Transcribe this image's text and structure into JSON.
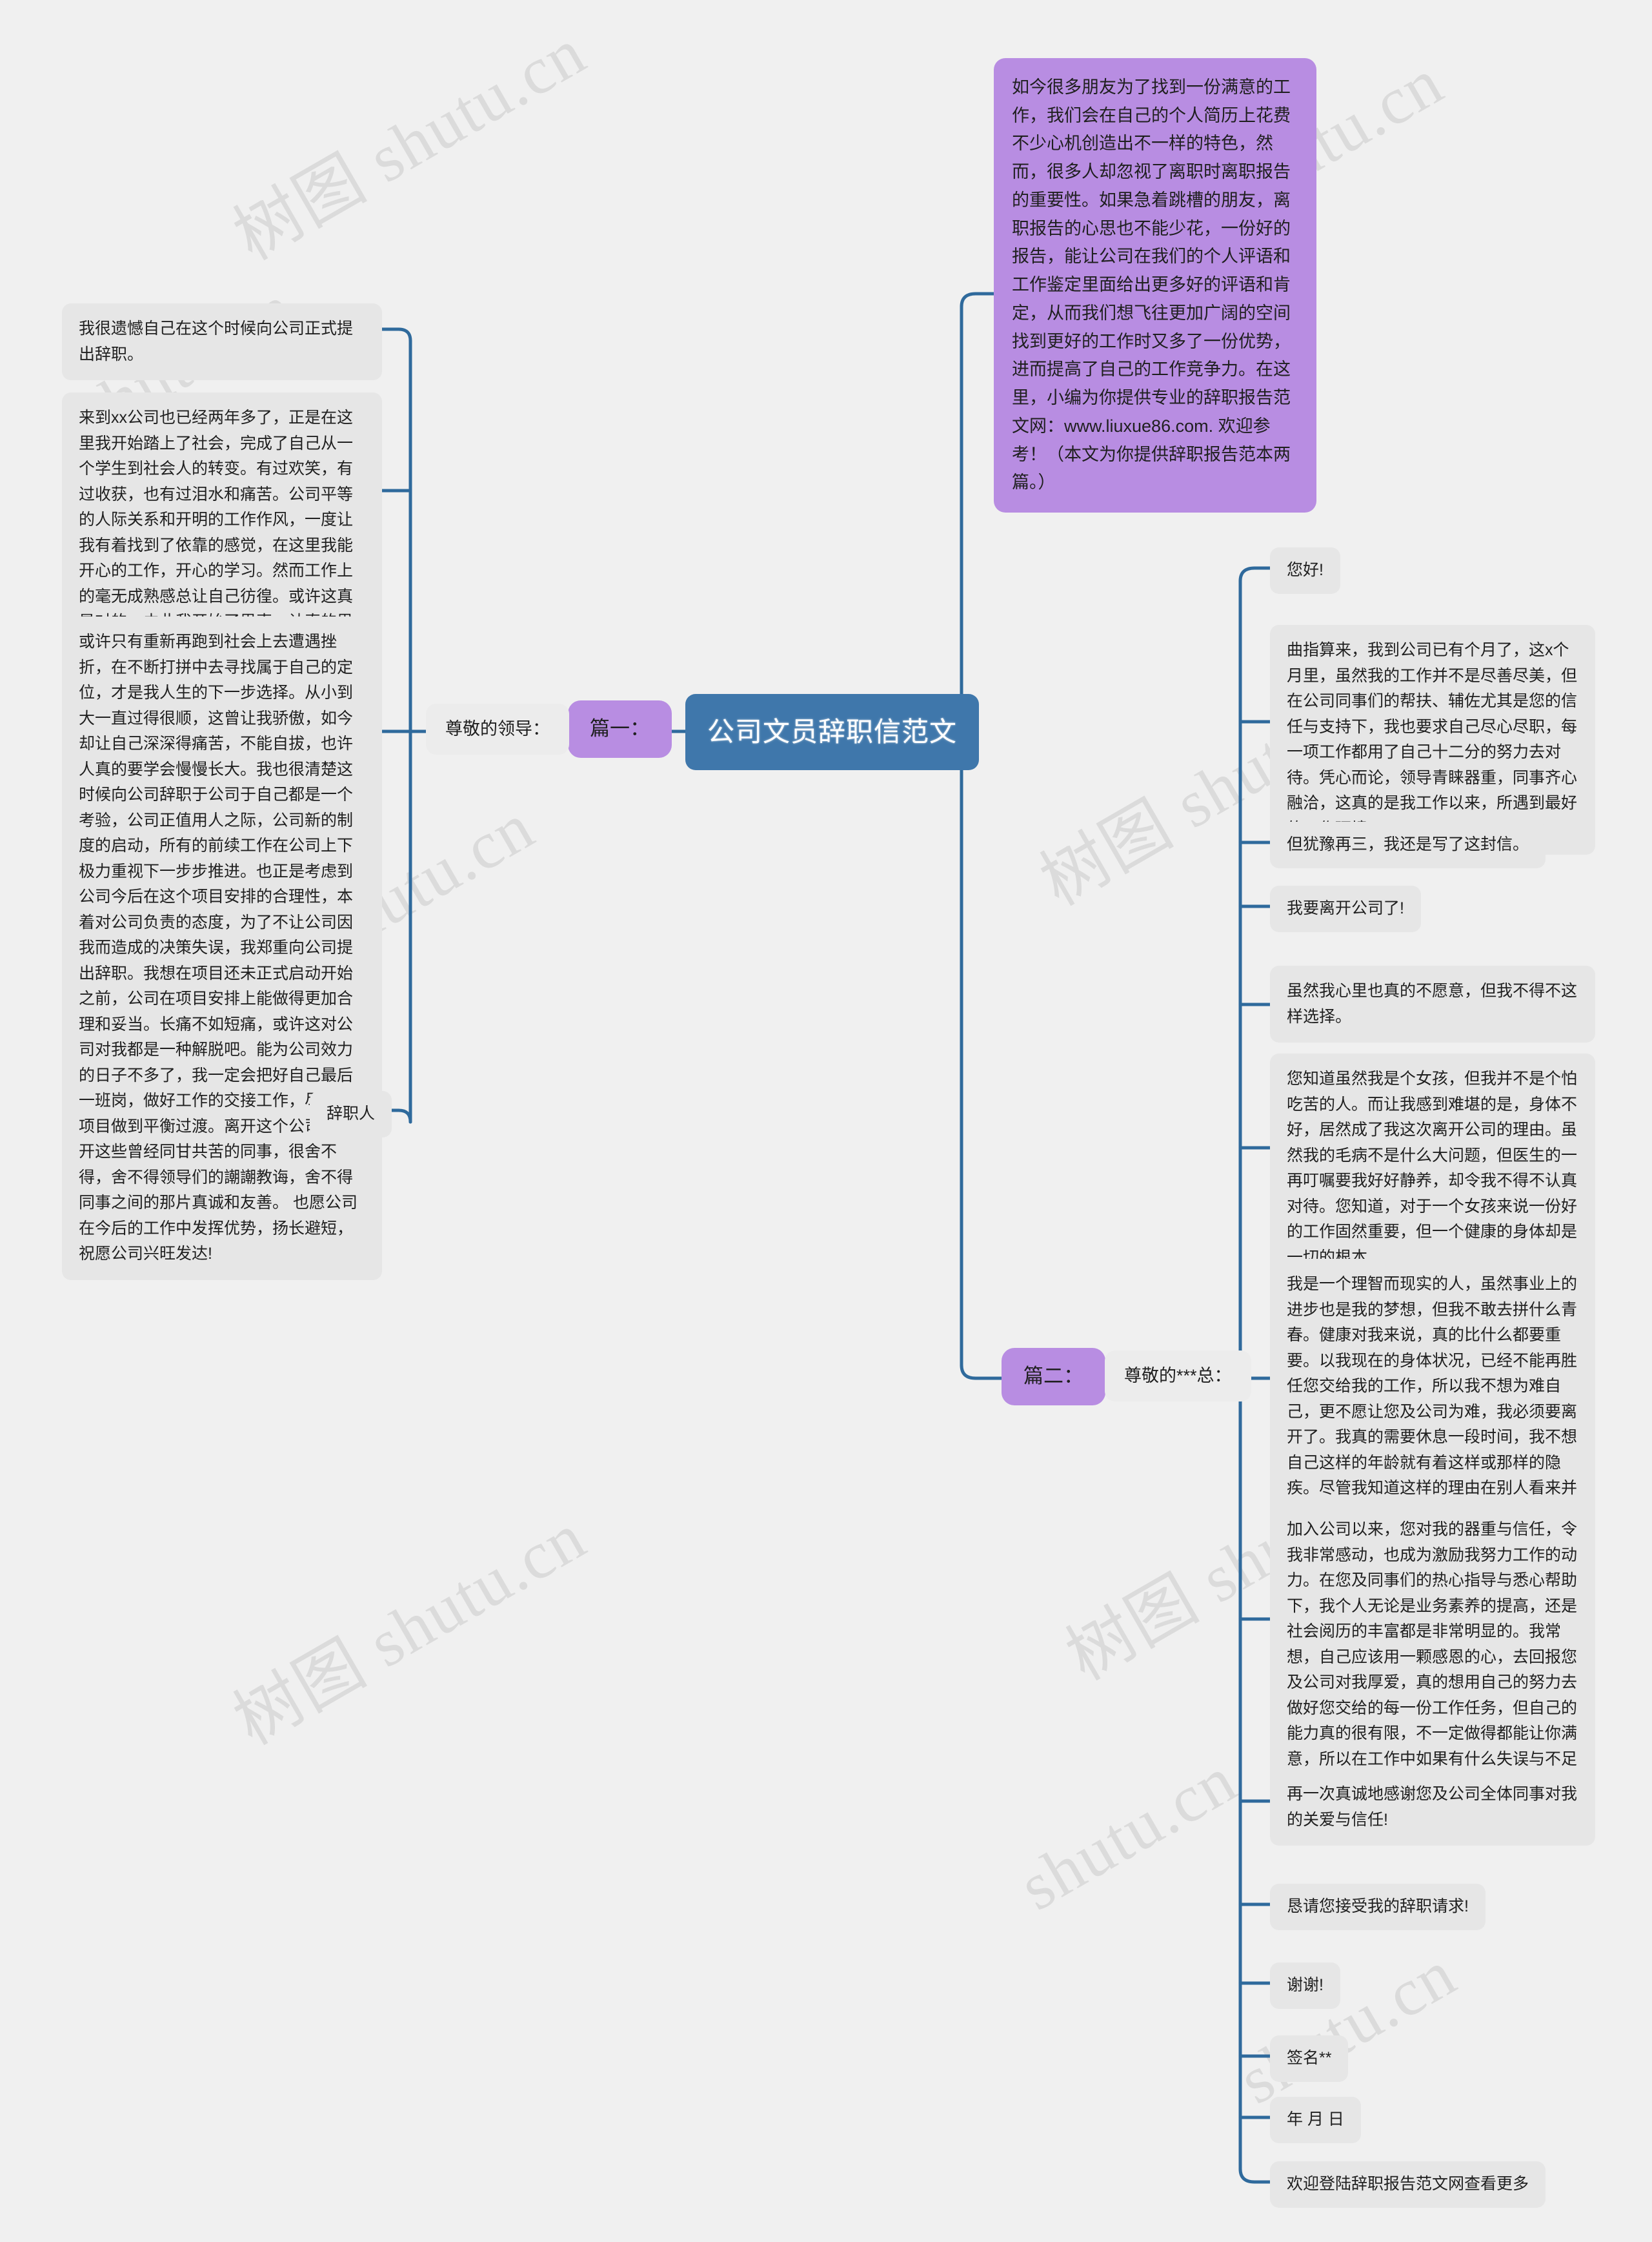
{
  "root": {
    "label": "公司文员辞职信范文",
    "color": "#3f77ab",
    "text_color": "#ffffff"
  },
  "colors": {
    "background": "#f0f0f0",
    "chapter_purple": "#b88de2",
    "leaf_gray": "#e6e6e6",
    "branch_gray": "#ececec",
    "edge_blue": "#2f6a9c"
  },
  "watermarks": {
    "primary": "树图 shutu.cn",
    "secondary": "shutu.cn"
  },
  "intro": {
    "text": "如今很多朋友为了找到一份满意的工作，我们会在自己的个人简历上花费不少心机创造出不一样的特色，然而，很多人却忽视了离职时离职报告的重要性。如果急着跳槽的朋友，离职报告的心思也不能少花，一份好的报告，能让公司在我们的个人评语和工作鉴定里面给出更多好的评语和肯定，从而我们想飞往更加广阔的空间找到更好的工作时又多了一份优势，进而提高了自己的工作竞争力。在这里，小编为你提供专业的辞职报告范文网：www.liuxue86.com. 欢迎参考！（本文为你提供辞职报告范本两篇。）"
  },
  "chapters": [
    {
      "id": "chapter-one",
      "label": "篇一：",
      "branch": {
        "label": "尊敬的领导：",
        "items": [
          "我很遗憾自己在这个时候向公司正式提出辞职。",
          "来到xx公司也已经两年多了，正是在这里我开始踏上了社会，完成了自己从一个学生到社会人的转变。有过欢笑，有过收获，也有过泪水和痛苦。公司平等的人际关系和开明的工作作风，一度让我有着找到了依靠的感觉，在这里我能开心的工作，开心的学习。然而工作上的毫无成熟感总让自己彷徨。或许这真是对的，由此我开始了思索，认真的思考。",
          "或许只有重新再跑到社会上去遭遇挫折，在不断打拼中去寻找属于自己的定位，才是我人生的下一步选择。从小到大一直过得很顺，这曾让我骄傲，如今却让自己深深得痛苦，不能自拔，也许人真的要学会慢慢长大。我也很清楚这时候向公司辞职于公司于自己都是一个考验，公司正值用人之际，公司新的制度的启动，所有的前续工作在公司上下极力重视下一步步推进。也正是考虑到公司今后在这个项目安排的合理性，本着对公司负责的态度，为了不让公司因我而造成的决策失误，我郑重向公司提出辞职。我想在项目还未正式启动开始之前，公司在项目安排上能做得更加合理和妥当。长痛不如短痛，或许这对公司对我都是一种解脱吧。能为公司效力的日子不多了，我一定会把好自己最后一班岗，做好工作的交接工作，尽力让项目做到平衡过渡。离开这个公司，离开这些曾经同甘共苦的同事，很舍不得，舍不得领导们的謿謿教诲，舍不得同事之间的那片真诚和友善。 也愿公司在今后的工作中发挥优势，扬长避短，祝愿公司兴旺发达!",
          "辞职人"
        ]
      }
    },
    {
      "id": "chapter-two",
      "label": "篇二：",
      "branch": {
        "label": "尊敬的***总：",
        "items": [
          "您好!",
          "曲指算来，我到公司已有个月了，这x个月里，虽然我的工作并不是尽善尽美，但在公司同事们的帮扶、辅佐尤其是您的信任与支持下，我也要求自己尽心尽职，每一项工作都用了自己十二分的努力去对待。凭心而论，领导青睐器重，同事齐心融洽，这真的是我工作以来，所遇到最好的工作环境。",
          "但犹豫再三，我还是写了这封信。",
          "我要离开公司了!",
          "虽然我心里也真的不愿意，但我不得不这样选择。",
          "您知道虽然我是个女孩，但我并不是个怕吃苦的人。而让我感到难堪的是，身体不好，居然成了我这次离开公司的理由。虽然我的毛病不是什么大问题，但医生的一再叮嘱要我好好静养，却令我不得不认真对待。您知道，对于一个女孩来说一份好的工作固然重要，但一个健康的身体却是一切的根本。",
          "我是一个理智而现实的人，虽然事业上的进步也是我的梦想，但我不敢去拼什么青春。健康对我来说，真的比什么都要重要。以我现在的身体状况，已经不能再胜任您交给我的工作，所以我不想为难自己，更不愿让您及公司为难，我必须要离开了。我真的需要休息一段时间，我不想自己这样的年龄就有着这样或那样的隐疾。尽管我知道这样的理由在别人看来并不算是什么，但对我来说它真的很重要，这点还希望你理解与谅解。",
          "加入公司以来，您对我的器重与信任，令我非常感动，也成为激励我努力工作的动力。在您及同事们的热心指导与悉心帮助下，我个人无论是业务素养的提高，还是社会阅历的丰富都是非常明显的。我常想，自己应该用一颗感恩的心，去回报您及公司对我厚爱，真的想用自己的努力去做好您交给的每一份工作任务，但自己的能力真的很有限，不一定做得都能让你满意，所以在工作中如果有什么失误与不足的地方，我只能对您说声抱歉，请您原谅!",
          "再一次真诚地感谢您及公司全体同事对我的关爱与信任!",
          "恳请您接受我的辞职请求!",
          "谢谢!",
          "签名**",
          "年 月 日",
          "欢迎登陆辞职报告范文网查看更多"
        ]
      }
    }
  ]
}
